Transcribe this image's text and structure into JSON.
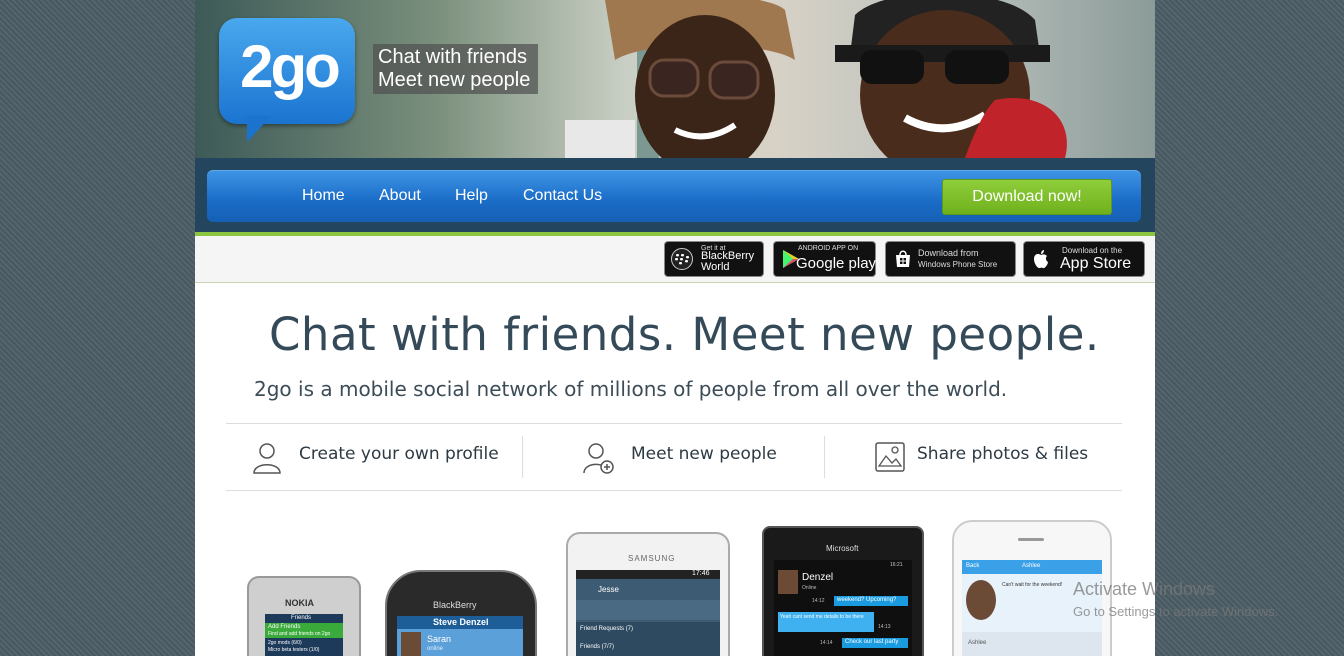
{
  "brand": {
    "logo_text": "2go",
    "tagline_line1": "Chat with friends",
    "tagline_line2": "Meet new people"
  },
  "nav": {
    "items": [
      {
        "label": "Home"
      },
      {
        "label": "About"
      },
      {
        "label": "Help"
      },
      {
        "label": "Contact Us"
      }
    ],
    "download_label": "Download now!"
  },
  "stores": {
    "blackberry": {
      "line1": "Get it at",
      "line2": "BlackBerry",
      "line3": "World"
    },
    "google": {
      "line1": "ANDROID APP ON",
      "line2": "Google play"
    },
    "windows": {
      "line1": "Download from",
      "line2": "Windows Phone Store"
    },
    "apple": {
      "line1": "Download on the",
      "line2": "App Store"
    }
  },
  "main": {
    "headline": "Chat with friends. Meet new people.",
    "subline": "2go is a mobile social network of millions of people from all over the world."
  },
  "features": [
    {
      "label": "Create your own profile",
      "icon": "user-icon"
    },
    {
      "label": "Meet new people",
      "icon": "add-user-icon"
    },
    {
      "label": "Share photos & files",
      "icon": "photo-icon"
    }
  ],
  "phones": {
    "nokia": {
      "brand": "NOKIA",
      "header": "Friends",
      "row1": "Add Friends",
      "row1b": "Find and add friends on 2go",
      "row2": "2go mods (6/0)",
      "row3": "Micro beta testers (1/0)"
    },
    "blackberry": {
      "brand": "BlackBerry",
      "header": "Steve Denzel",
      "contact": "Saran",
      "status": "online"
    },
    "samsung": {
      "brand": "SAMSUNG",
      "time": "17:46",
      "contact": "Jesse",
      "row1": "Friend Requests (7)",
      "row2": "Friends (7/7)"
    },
    "microsoft": {
      "brand": "Microsoft",
      "time": "16:21",
      "contact": "Denzel",
      "status": "Online",
      "msg1": "weekend? Upcoming?",
      "msg1_time": "14:12",
      "msg2": "Yeah cant send me details to be there",
      "msg2_time": "14:13",
      "msg3": "Check our last party",
      "msg3_time": "14:14"
    },
    "iphone": {
      "back": "Back",
      "contact": "Ashlee",
      "msg": "Can't wait for the weekend!",
      "name2": "Ashlee"
    }
  },
  "watermark": {
    "line1": "Activate Windows",
    "line2": "Go to Settings to activate Windows."
  },
  "colors": {
    "nav_blue": "#1a6cc6",
    "download_green": "#7cbf2a",
    "accent_green": "#8cc63f",
    "headline": "#344a58"
  }
}
